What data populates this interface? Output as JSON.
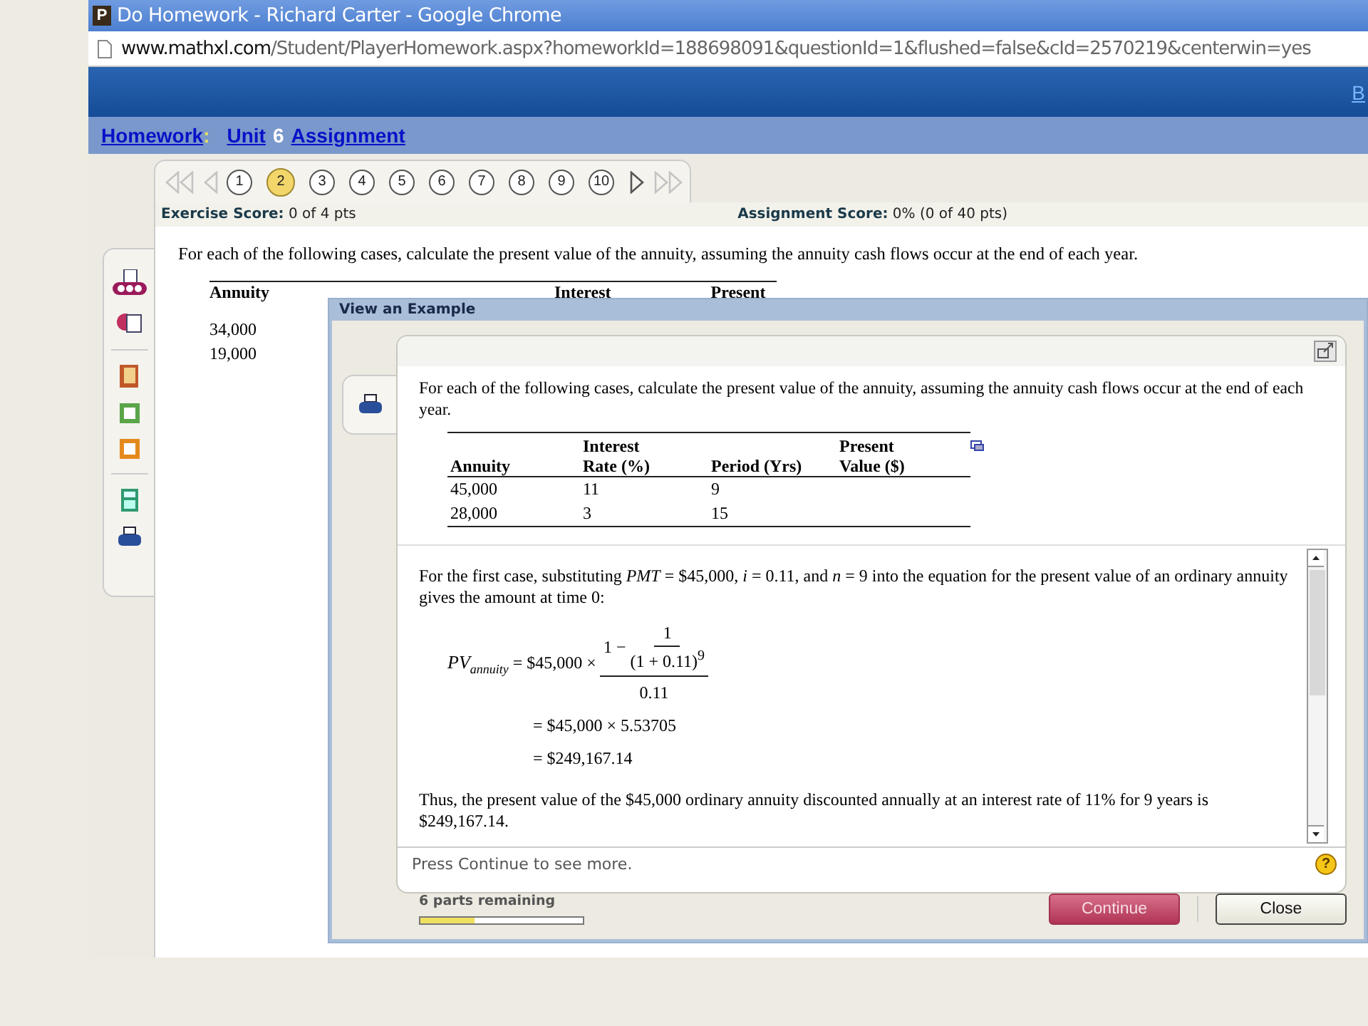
{
  "window": {
    "title": "Do Homework - Richard Carter - Google Chrome",
    "app_icon": "P"
  },
  "address_bar": {
    "host": "www.mathxl.com",
    "path": "/Student/PlayerHomework.aspx?homeworkId=188698091&questionId=1&flushed=false&cId=2570219&centerwin=yes"
  },
  "header": {
    "link_cut": "B"
  },
  "breadcrumb": {
    "homework": "Homework",
    "separator": ":",
    "unit": "Unit",
    "unit_number": "6",
    "assignment": "Assignment"
  },
  "question_nav": {
    "first_disabled": true,
    "prev_disabled": true,
    "next_disabled": false,
    "last_disabled": true,
    "questions": [
      {
        "label": "1",
        "selected": false
      },
      {
        "label": "2",
        "selected": true
      },
      {
        "label": "3",
        "selected": false
      },
      {
        "label": "4",
        "selected": false
      },
      {
        "label": "5",
        "selected": false
      },
      {
        "label": "6",
        "selected": false
      },
      {
        "label": "7",
        "selected": false
      },
      {
        "label": "8",
        "selected": false
      },
      {
        "label": "9",
        "selected": false
      },
      {
        "label": "10",
        "selected": false
      }
    ]
  },
  "scores": {
    "exercise_label": "Exercise Score:",
    "exercise_value": "0 of 4 pts",
    "assignment_label": "Assignment Score:",
    "assignment_value": "0% (0 of 40 pts)"
  },
  "question": {
    "text": "For each of the following cases, calculate the present value of the annuity, assuming the annuity cash flows occur at the end of each year.",
    "table": {
      "columns": [
        "Annuity",
        "Interest",
        "Present"
      ],
      "rows": [
        [
          "34,000"
        ],
        [
          "19,000"
        ]
      ]
    }
  },
  "dialog": {
    "title": "View an Example",
    "prompt": "For each of the following cases, calculate the present value of the annuity, assuming the annuity cash flows occur at the end of each year.",
    "table": {
      "columns": [
        "Annuity",
        "Interest\nRate (%)",
        "Period (Yrs)",
        "Present\nValue ($)"
      ],
      "rows": [
        [
          "45,000",
          "11",
          "9",
          ""
        ],
        [
          "28,000",
          "3",
          "15",
          ""
        ]
      ]
    },
    "solution": {
      "intro": "For the first case, substituting *PMT* = $45,000, *i* = 0.11, and *n* = 9 into the equation for the present value of an ordinary annuity gives the amount at time 0:",
      "formula": {
        "lhs": "PV",
        "lhs_sub": "annuity",
        "factor": "= $45,000 ×",
        "one_minus": "1 −",
        "inner_numerator": "1",
        "inner_denominator": "(1 + 0.11)$^{9}$",
        "denominator": "0.11",
        "steps": [
          "= $45,000 × 5.53705",
          "= $249,167.14"
        ]
      },
      "conclusion": "Thus, the present value of the $45,000 ordinary annuity discounted annually at an interest rate of 11% for 9 years is $249,167.14."
    },
    "hint": "Press Continue to see more.",
    "help_glyph": "?",
    "parts_remaining": "6 parts remaining",
    "progress": {
      "level": 0.33
    },
    "buttons": [
      {
        "label": "Continue",
        "kind": "primary"
      },
      {
        "label": "Close",
        "kind": "secondary"
      }
    ]
  }
}
